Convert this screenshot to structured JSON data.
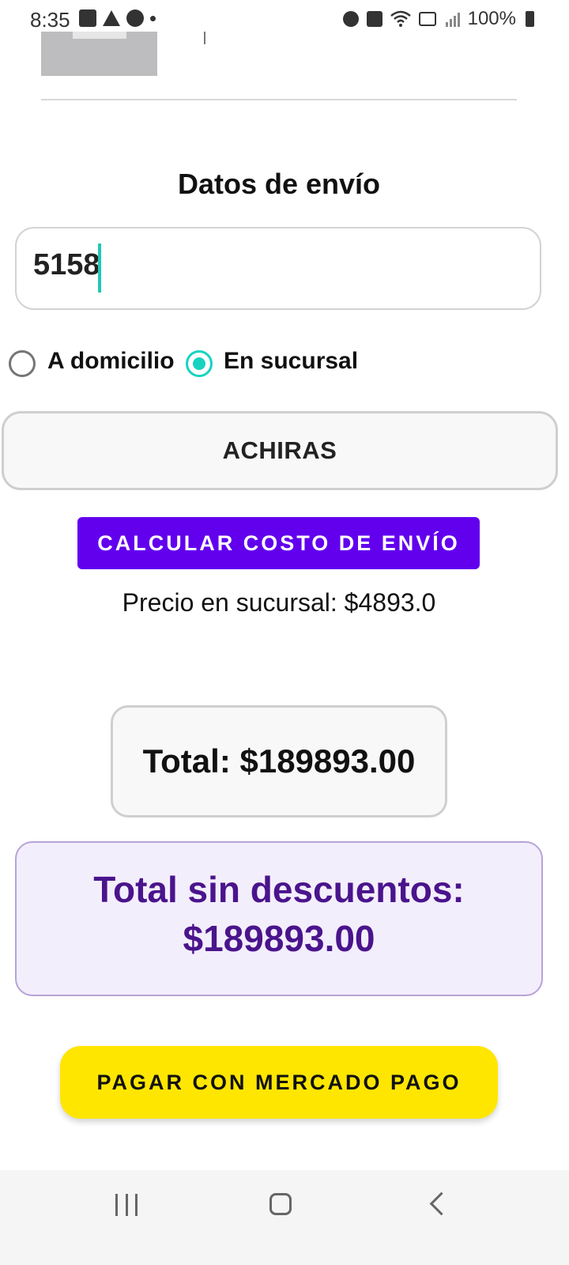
{
  "status_bar": {
    "time": "8:35",
    "battery": "100%",
    "left_icons": [
      "gallery-icon",
      "drive-icon",
      "alarm-icon",
      "dot-icon"
    ],
    "right_icons": [
      "alarm-icon",
      "mute-icon",
      "wifi-icon",
      "volte-icon",
      "signal-icon",
      "battery-icon"
    ]
  },
  "shipping": {
    "title": "Datos de envío",
    "zip_value": "5158",
    "options": [
      {
        "label": "A domicilio",
        "selected": false
      },
      {
        "label": "En sucursal",
        "selected": true
      }
    ],
    "branch": "ACHIRAS",
    "calc_button": "CALCULAR COSTO DE ENVÍO",
    "branch_price": "Precio en sucursal: $4893.0"
  },
  "totals": {
    "total": "Total: $189893.00",
    "no_discount_label": "Total sin descuentos:",
    "no_discount_value": "$189893.00"
  },
  "pay_button": "PAGAR CON MERCADO PAGO",
  "colors": {
    "accent_teal": "#16d3c0",
    "primary_purple": "#6200ee",
    "deep_purple_text": "#4a148c",
    "pay_yellow": "#ffe600"
  },
  "nav_bar": {
    "icons": [
      "recents-icon",
      "home-icon",
      "back-icon"
    ]
  }
}
